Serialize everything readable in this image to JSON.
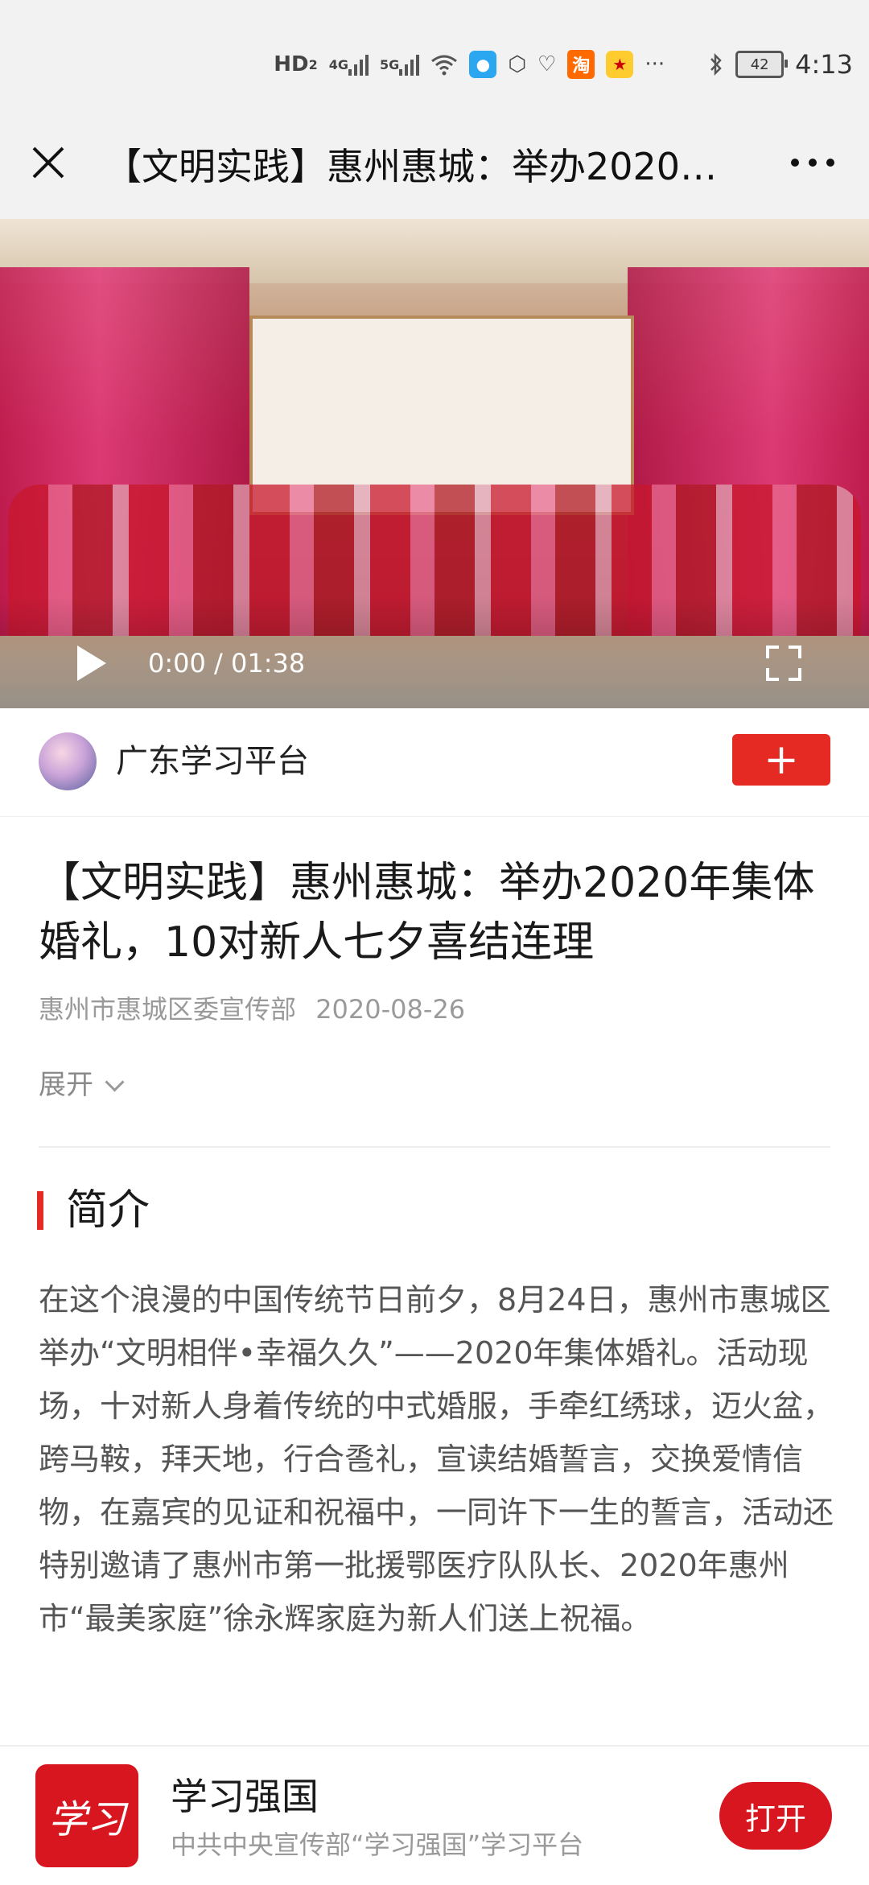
{
  "status_bar": {
    "hd_label": "HD",
    "hd_sub": "2",
    "net1": "4G",
    "net2": "5G",
    "taobao_label": "淘",
    "battery": "42",
    "time": "4:13",
    "more": "···"
  },
  "title_bar": {
    "title": "【文明实践】惠州惠城：举办2020…",
    "close_icon": "close-icon",
    "more_icon": "more-icon"
  },
  "video": {
    "time": "0:00 / 01:38",
    "progress": 0
  },
  "channel": {
    "name": "广东学习平台",
    "follow_label": "+"
  },
  "article": {
    "title": "【文明实践】惠州惠城：举办2020年集体婚礼，10对新人七夕喜结连理",
    "source": "惠州市惠城区委宣传部",
    "date": "2020-08-26",
    "expand_label": "展开",
    "section_title": "简介",
    "body": "在这个浪漫的中国传统节日前夕，8月24日，惠州市惠城区举办“文明相伴•幸福久久”——2020年集体婚礼。活动现场，十对新人身着传统的中式婚服，手牵红绣球，迈火盆，跨马鞍，拜天地，行合卺礼，宣读结婚誓言，交换爱情信物，在嘉宾的见证和祝福中，一同许下一生的誓言，活动还特别邀请了惠州市第一批援鄂医疗队队长、2020年惠州市“最美家庭”徐永辉家庭为新人们送上祝福。"
  },
  "app_banner": {
    "logo_text": "学习",
    "name": "学习强国",
    "desc": "中共中央宣传部“学习强国”学习平台",
    "open_label": "打开"
  },
  "colors": {
    "accent_red": "#e52a24",
    "app_red": "#d8161f"
  }
}
